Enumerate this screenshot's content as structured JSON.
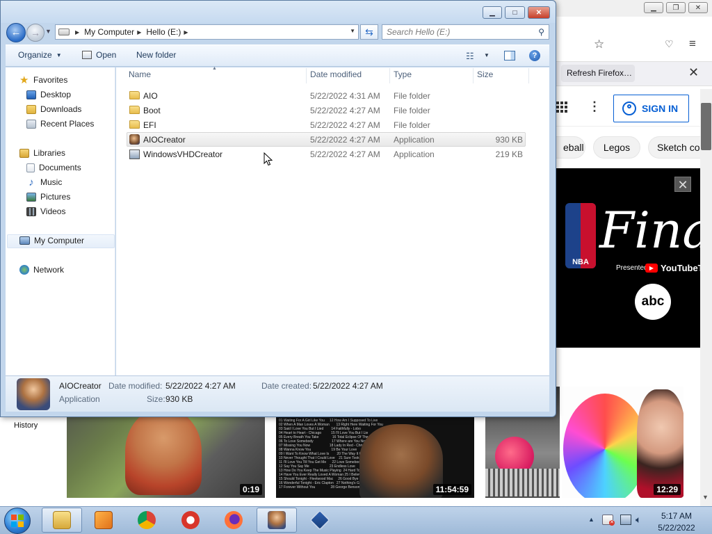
{
  "browser": {
    "refresh_button": "Refresh Firefox…",
    "signin": "SIGN IN",
    "chips": [
      "eball",
      "Legos",
      "Sketch co"
    ],
    "history": "History",
    "ad": {
      "finals_text": "Fina",
      "presented_by": "Presented by",
      "youtube_word": "YouTubeT",
      "abc": "abc",
      "nba": "NBA"
    },
    "thumbnails": [
      {
        "duration": "0:19"
      },
      {
        "duration": "11:54:59"
      },
      {
        "duration": ""
      },
      {
        "duration": "12:29"
      }
    ],
    "tracklist": "01 Waiting For A Girl Like You     12 How Am I Supposed To Live\n02 When A Man Loves A Woman       13 Right Here Waiting For You\n03 Said I Love You But I Lied        14 Faithfully - Lobo\n04 Heart to Heart - Chicago          15 I'll Love You But I Lie\n05 Every Breath You Take              16 Total Eclipse Of The Heart\n06 To Love Somebody                   17 Where are You Now\n07 Missing You Now                    18 Lady In Red - Chris De Burgh\n08 Wanna Know You                     19 Be Your Love\n09 I Want To Know What Love Is        20 The Way It Used To Be\n10 Never Thought That I Could Love    21 Sure Took A Long Time\n11 I'll Love You Till You Get Me      22 Love Somebody\n12 Say You Say Me                     23 Endless Love\n13 How Do You Keep The Music Playing  24 Hard To Say I'm Sorry\n14 Have You Ever Really Loved A Woman 25 I Believe I Can Fly\n15 Should Tonight - Fleetwood Mac     26 Good Bye - Air Supply\n16 Wonderful Tonight - Eric Clapton   27 Nothing's Gonna Change\n17 Forever Without You                28 George Benson"
  },
  "explorer": {
    "address": {
      "crumbs": [
        "My Computer",
        "Hello (E:)"
      ]
    },
    "search_placeholder": "Search Hello (E:)",
    "toolbar": {
      "organize": "Organize",
      "open": "Open",
      "new_folder": "New folder"
    },
    "nav": {
      "favorites": "Favorites",
      "desktop": "Desktop",
      "downloads": "Downloads",
      "recent_places": "Recent Places",
      "libraries": "Libraries",
      "documents": "Documents",
      "music": "Music",
      "pictures": "Pictures",
      "videos": "Videos",
      "my_computer": "My Computer",
      "network": "Network"
    },
    "columns": {
      "name": "Name",
      "date": "Date modified",
      "type": "Type",
      "size": "Size"
    },
    "files": [
      {
        "name": "AIO",
        "date": "5/22/2022 4:31 AM",
        "type": "File folder",
        "size": ""
      },
      {
        "name": "Boot",
        "date": "5/22/2022 4:27 AM",
        "type": "File folder",
        "size": ""
      },
      {
        "name": "EFI",
        "date": "5/22/2022 4:27 AM",
        "type": "File folder",
        "size": ""
      },
      {
        "name": "AIOCreator",
        "date": "5/22/2022 4:27 AM",
        "type": "Application",
        "size": "930 KB"
      },
      {
        "name": "WindowsVHDCreator",
        "date": "5/22/2022 4:27 AM",
        "type": "Application",
        "size": "219 KB"
      }
    ],
    "details": {
      "name": "AIOCreator",
      "kind": "Application",
      "date_modified_label": "Date modified:",
      "date_modified": "5/22/2022 4:27 AM",
      "date_created_label": "Date created:",
      "date_created": "5/22/2022 4:27 AM",
      "size_label": "Size:",
      "size": "930 KB"
    }
  },
  "taskbar": {
    "time": "5:17 AM",
    "date": "5/22/2022"
  }
}
